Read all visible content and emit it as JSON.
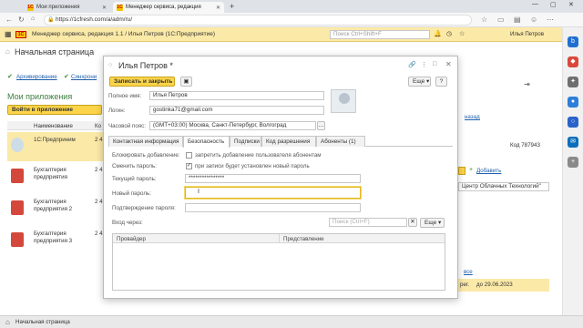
{
  "browser": {
    "tabs": [
      {
        "label": "Мои приложения"
      },
      {
        "label": "Менеджер сервиса, редакция"
      }
    ],
    "url": "https://1cfresh.com/a/adm/ru/"
  },
  "app_header": {
    "title": "Менеджер сервиса, редакция 1.1 / Илья Петров (1С:Предприятие)",
    "search_placeholder": "Поиск Ctrl+Shift+F",
    "user": "Илья Петров"
  },
  "background": {
    "page_title": "Начальная страница",
    "archive_link": "Архивирование",
    "sync_link": "Синхрони",
    "section_title": "Мои приложения",
    "enter_button": "Войти в приложение",
    "col_name": "Наименование",
    "col_code": "Ко",
    "apps": [
      {
        "name": "1С:Предприним",
        "code": "2 4"
      },
      {
        "name": "Бухгалтерия предприятия",
        "code": "2 4"
      },
      {
        "name": "Бухгалтерия предприятия 2",
        "code": "2 4"
      },
      {
        "name": "Бухгалтерия предприятия 3",
        "code": "2 4"
      }
    ],
    "right_link_back": "назад",
    "right_code": "Код 787943",
    "right_add": "Добавить",
    "right_company": "Центр Облачных Технологий\"",
    "right_all": "все",
    "right_reg": "рег.",
    "right_date": "до 29.06.2023"
  },
  "dialog": {
    "title": "Илья Петров *",
    "save_close": "Записать и закрыть",
    "more": "Еще",
    "help": "?",
    "full_name_label": "Полное имя:",
    "full_name": "Илья Петров",
    "login_label": "Логин:",
    "login": "gostinka71@gmail.com",
    "tz_label": "Часовой пояс:",
    "tz": "(GMT+03:00) Москва, Санкт-Петербург, Волгоград",
    "tabs": [
      {
        "label": "Контактная информация"
      },
      {
        "label": "Безопасность"
      },
      {
        "label": "Подписки"
      },
      {
        "label": "Код разрешения"
      },
      {
        "label": "Абоненты (1)"
      }
    ],
    "block_label": "Блокировать добавление:",
    "block_text": "запретить добавление пользователя абонентам",
    "change_pwd_label": "Сменить пароль:",
    "change_pwd_text": "при записи будет установлен новый пароль",
    "cur_pwd_label": "Текущий пароль:",
    "cur_pwd_value": "****************",
    "new_pwd_label": "Новый пароль:",
    "confirm_pwd_label": "Подтверждение пароля:",
    "login_via_label": "Вход через:",
    "search_placeholder": "Поиск (Ctrl+F)",
    "more2": "Еще",
    "grid_col_provider": "Провайдер",
    "grid_col_repr": "Представление"
  },
  "taskbar": {
    "home_label": "Начальная страница"
  }
}
